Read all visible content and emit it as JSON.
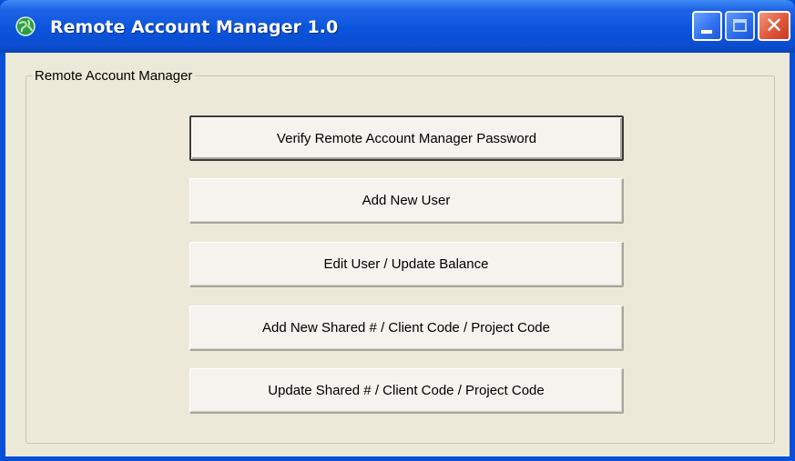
{
  "window": {
    "title": "Remote Account Manager 1.0",
    "app_icon": "globe-icon",
    "controls": {
      "minimize_icon": "minimize-icon",
      "maximize_icon": "maximize-icon",
      "close_icon": "close-icon",
      "close_glyph": "✕"
    }
  },
  "group": {
    "label": "Remote Account Manager"
  },
  "buttons": [
    {
      "label": "Verify Remote Account Manager Password",
      "default": true
    },
    {
      "label": "Add New User"
    },
    {
      "label": "Edit User / Update Balance"
    },
    {
      "label": "Add New Shared # / Client Code / Project Code"
    },
    {
      "label": "Update Shared # / Client Code / Project Code"
    }
  ],
  "colors": {
    "titlebar": "#0a54dc",
    "client_background": "#ece9d8",
    "close_button": "#e0573a"
  }
}
